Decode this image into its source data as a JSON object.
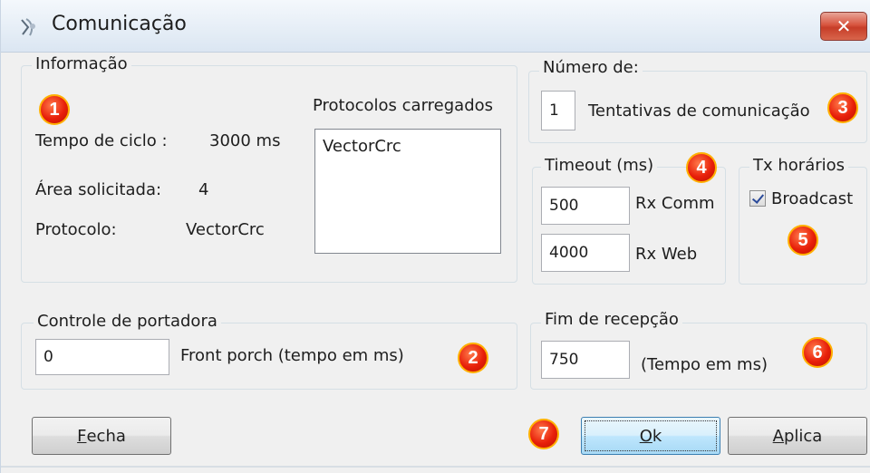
{
  "window": {
    "title": "Comunicação",
    "close_label": "✕"
  },
  "informacao": {
    "legend": "Informação",
    "badge": "1",
    "tempo_ciclo_label": "Tempo de ciclo :",
    "tempo_ciclo_value": "3000 ms",
    "area_label": "Área solicitada:",
    "area_value": "4",
    "protocolo_label": "Protocolo:",
    "protocolo_value": "VectorCrc",
    "protocolos_label": "Protocolos carregados",
    "protocolos_list": [
      "VectorCrc"
    ]
  },
  "numero": {
    "legend": "Número de:",
    "tentativas_value": "1",
    "tentativas_label": "Tentativas de comunicação",
    "badge": "3"
  },
  "timeout": {
    "legend": "Timeout (ms)",
    "badge": "4",
    "rx_comm_value": "500",
    "rx_comm_label": "Rx Comm",
    "rx_web_value": "4000",
    "rx_web_label": "Rx Web"
  },
  "tx": {
    "legend": "Tx horários",
    "broadcast_label": "Broadcast",
    "broadcast_checked": true,
    "badge": "5"
  },
  "portadora": {
    "legend": "Controle de portadora",
    "value": "0",
    "label": "Front porch (tempo em ms)",
    "badge": "2"
  },
  "fim": {
    "legend": "Fim de recepção",
    "value": "750",
    "label": "(Tempo em ms)",
    "badge": "6"
  },
  "buttons": {
    "fecha_first": "F",
    "fecha_rest": "echa",
    "ok_first": "O",
    "ok_rest": "k",
    "aplica_first": "A",
    "aplica_rest": "plica",
    "badge": "7"
  }
}
